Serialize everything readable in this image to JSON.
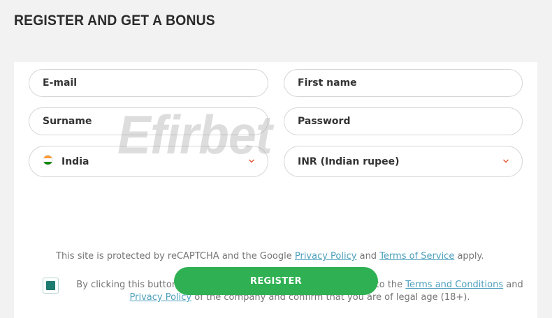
{
  "page": {
    "title": "REGISTER AND GET A BONUS"
  },
  "form": {
    "email_placeholder": "E-mail",
    "first_name_placeholder": "First name",
    "surname_placeholder": "Surname",
    "password_placeholder": "Password",
    "country": {
      "value": "India",
      "flag": "india-flag-icon"
    },
    "currency": {
      "value": "INR (Indian rupee)"
    }
  },
  "watermark": "Efirbet",
  "recaptcha": {
    "prefix": "This site is protected by reCAPTCHA and the Google ",
    "privacy_link": "Privacy Policy",
    "middle": " and ",
    "terms_link": "Terms of Service",
    "suffix": " apply."
  },
  "consent": {
    "checked": true,
    "prefix": "By clicking this button you confirm that you have read and agree to the ",
    "terms_link": "Terms and Conditions",
    "middle": " and ",
    "privacy_link": "Privacy Policy",
    "suffix": " of the company and confirm that you are of legal age (18+)."
  },
  "register_button": {
    "label": "REGISTER",
    "color": "#2fb052"
  },
  "colors": {
    "accent_link": "#4d9fbd",
    "checkbox": "#1d7b70"
  }
}
